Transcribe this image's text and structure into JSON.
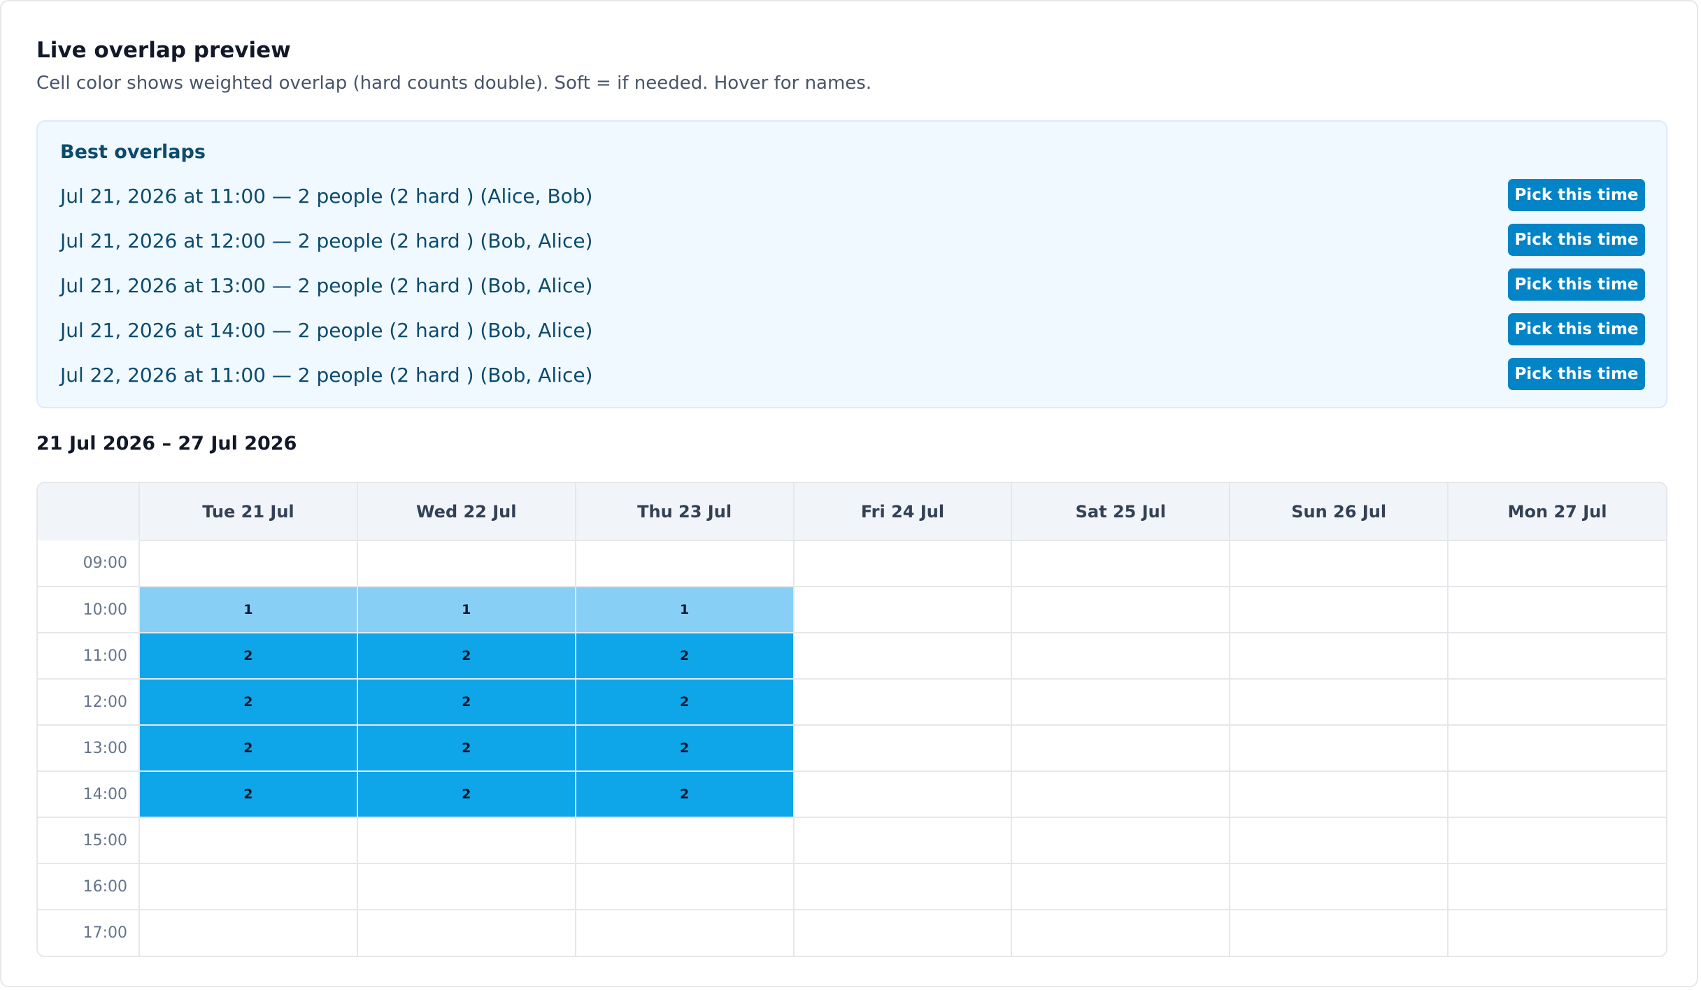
{
  "header": {
    "title": "Live overlap preview",
    "subtitle": "Cell color shows weighted overlap (hard counts double). Soft = if needed. Hover for names."
  },
  "best_overlaps": {
    "title": "Best overlaps",
    "button_label": "Pick this time",
    "items": [
      {
        "text": "Jul 21, 2026 at 11:00 — 2 people (2 hard ) (Alice, Bob)"
      },
      {
        "text": "Jul 21, 2026 at 12:00 — 2 people (2 hard ) (Bob, Alice)"
      },
      {
        "text": "Jul 21, 2026 at 13:00 — 2 people (2 hard ) (Bob, Alice)"
      },
      {
        "text": "Jul 21, 2026 at 14:00 — 2 people (2 hard ) (Bob, Alice)"
      },
      {
        "text": "Jul 22, 2026 at 11:00 — 2 people (2 hard ) (Bob, Alice)"
      }
    ]
  },
  "calendar": {
    "range_label": "21 Jul 2026 – 27 Jul 2026",
    "days": [
      "Tue 21 Jul",
      "Wed 22 Jul",
      "Thu 23 Jul",
      "Fri 24 Jul",
      "Sat 25 Jul",
      "Sun 26 Jul",
      "Mon 27 Jul"
    ],
    "times": [
      "09:00",
      "10:00",
      "11:00",
      "12:00",
      "13:00",
      "14:00",
      "15:00",
      "16:00",
      "17:00"
    ],
    "counts": [
      [
        "",
        "",
        "",
        "",
        "",
        "",
        ""
      ],
      [
        "1",
        "1",
        "1",
        "",
        "",
        "",
        ""
      ],
      [
        "2",
        "2",
        "2",
        "",
        "",
        "",
        ""
      ],
      [
        "2",
        "2",
        "2",
        "",
        "",
        "",
        ""
      ],
      [
        "2",
        "2",
        "2",
        "",
        "",
        "",
        ""
      ],
      [
        "2",
        "2",
        "2",
        "",
        "",
        "",
        ""
      ],
      [
        "",
        "",
        "",
        "",
        "",
        "",
        ""
      ],
      [
        "",
        "",
        "",
        "",
        "",
        "",
        ""
      ],
      [
        "",
        "",
        "",
        "",
        "",
        "",
        ""
      ]
    ]
  },
  "colors": {
    "overlap_level_1": "#87cff5",
    "overlap_level_2": "#0ea5e9",
    "button": "#0284c7",
    "panel_background": "#f0f9ff"
  }
}
